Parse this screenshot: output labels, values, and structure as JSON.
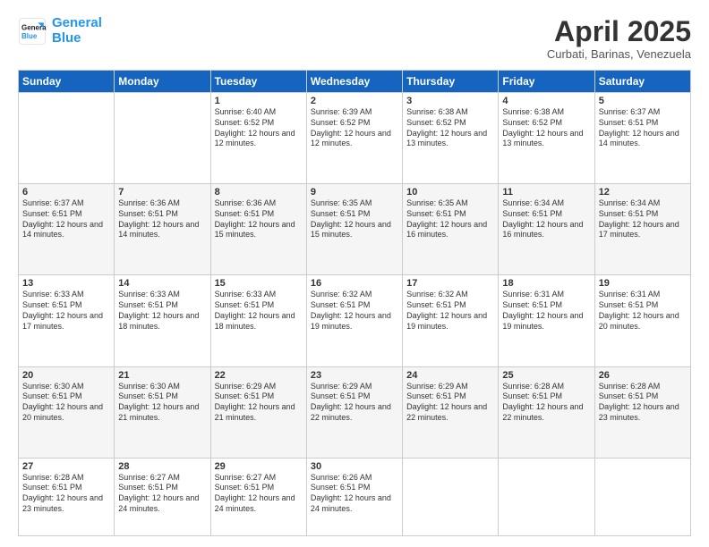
{
  "logo": {
    "line1": "General",
    "line2": "Blue"
  },
  "title": "April 2025",
  "subtitle": "Curbati, Barinas, Venezuela",
  "days_of_week": [
    "Sunday",
    "Monday",
    "Tuesday",
    "Wednesday",
    "Thursday",
    "Friday",
    "Saturday"
  ],
  "weeks": [
    [
      {
        "day": "",
        "content": ""
      },
      {
        "day": "",
        "content": ""
      },
      {
        "day": "1",
        "content": "Sunrise: 6:40 AM\nSunset: 6:52 PM\nDaylight: 12 hours and 12 minutes."
      },
      {
        "day": "2",
        "content": "Sunrise: 6:39 AM\nSunset: 6:52 PM\nDaylight: 12 hours and 12 minutes."
      },
      {
        "day": "3",
        "content": "Sunrise: 6:38 AM\nSunset: 6:52 PM\nDaylight: 12 hours and 13 minutes."
      },
      {
        "day": "4",
        "content": "Sunrise: 6:38 AM\nSunset: 6:52 PM\nDaylight: 12 hours and 13 minutes."
      },
      {
        "day": "5",
        "content": "Sunrise: 6:37 AM\nSunset: 6:51 PM\nDaylight: 12 hours and 14 minutes."
      }
    ],
    [
      {
        "day": "6",
        "content": "Sunrise: 6:37 AM\nSunset: 6:51 PM\nDaylight: 12 hours and 14 minutes."
      },
      {
        "day": "7",
        "content": "Sunrise: 6:36 AM\nSunset: 6:51 PM\nDaylight: 12 hours and 14 minutes."
      },
      {
        "day": "8",
        "content": "Sunrise: 6:36 AM\nSunset: 6:51 PM\nDaylight: 12 hours and 15 minutes."
      },
      {
        "day": "9",
        "content": "Sunrise: 6:35 AM\nSunset: 6:51 PM\nDaylight: 12 hours and 15 minutes."
      },
      {
        "day": "10",
        "content": "Sunrise: 6:35 AM\nSunset: 6:51 PM\nDaylight: 12 hours and 16 minutes."
      },
      {
        "day": "11",
        "content": "Sunrise: 6:34 AM\nSunset: 6:51 PM\nDaylight: 12 hours and 16 minutes."
      },
      {
        "day": "12",
        "content": "Sunrise: 6:34 AM\nSunset: 6:51 PM\nDaylight: 12 hours and 17 minutes."
      }
    ],
    [
      {
        "day": "13",
        "content": "Sunrise: 6:33 AM\nSunset: 6:51 PM\nDaylight: 12 hours and 17 minutes."
      },
      {
        "day": "14",
        "content": "Sunrise: 6:33 AM\nSunset: 6:51 PM\nDaylight: 12 hours and 18 minutes."
      },
      {
        "day": "15",
        "content": "Sunrise: 6:33 AM\nSunset: 6:51 PM\nDaylight: 12 hours and 18 minutes."
      },
      {
        "day": "16",
        "content": "Sunrise: 6:32 AM\nSunset: 6:51 PM\nDaylight: 12 hours and 19 minutes."
      },
      {
        "day": "17",
        "content": "Sunrise: 6:32 AM\nSunset: 6:51 PM\nDaylight: 12 hours and 19 minutes."
      },
      {
        "day": "18",
        "content": "Sunrise: 6:31 AM\nSunset: 6:51 PM\nDaylight: 12 hours and 19 minutes."
      },
      {
        "day": "19",
        "content": "Sunrise: 6:31 AM\nSunset: 6:51 PM\nDaylight: 12 hours and 20 minutes."
      }
    ],
    [
      {
        "day": "20",
        "content": "Sunrise: 6:30 AM\nSunset: 6:51 PM\nDaylight: 12 hours and 20 minutes."
      },
      {
        "day": "21",
        "content": "Sunrise: 6:30 AM\nSunset: 6:51 PM\nDaylight: 12 hours and 21 minutes."
      },
      {
        "day": "22",
        "content": "Sunrise: 6:29 AM\nSunset: 6:51 PM\nDaylight: 12 hours and 21 minutes."
      },
      {
        "day": "23",
        "content": "Sunrise: 6:29 AM\nSunset: 6:51 PM\nDaylight: 12 hours and 22 minutes."
      },
      {
        "day": "24",
        "content": "Sunrise: 6:29 AM\nSunset: 6:51 PM\nDaylight: 12 hours and 22 minutes."
      },
      {
        "day": "25",
        "content": "Sunrise: 6:28 AM\nSunset: 6:51 PM\nDaylight: 12 hours and 22 minutes."
      },
      {
        "day": "26",
        "content": "Sunrise: 6:28 AM\nSunset: 6:51 PM\nDaylight: 12 hours and 23 minutes."
      }
    ],
    [
      {
        "day": "27",
        "content": "Sunrise: 6:28 AM\nSunset: 6:51 PM\nDaylight: 12 hours and 23 minutes."
      },
      {
        "day": "28",
        "content": "Sunrise: 6:27 AM\nSunset: 6:51 PM\nDaylight: 12 hours and 24 minutes."
      },
      {
        "day": "29",
        "content": "Sunrise: 6:27 AM\nSunset: 6:51 PM\nDaylight: 12 hours and 24 minutes."
      },
      {
        "day": "30",
        "content": "Sunrise: 6:26 AM\nSunset: 6:51 PM\nDaylight: 12 hours and 24 minutes."
      },
      {
        "day": "",
        "content": ""
      },
      {
        "day": "",
        "content": ""
      },
      {
        "day": "",
        "content": ""
      }
    ]
  ]
}
